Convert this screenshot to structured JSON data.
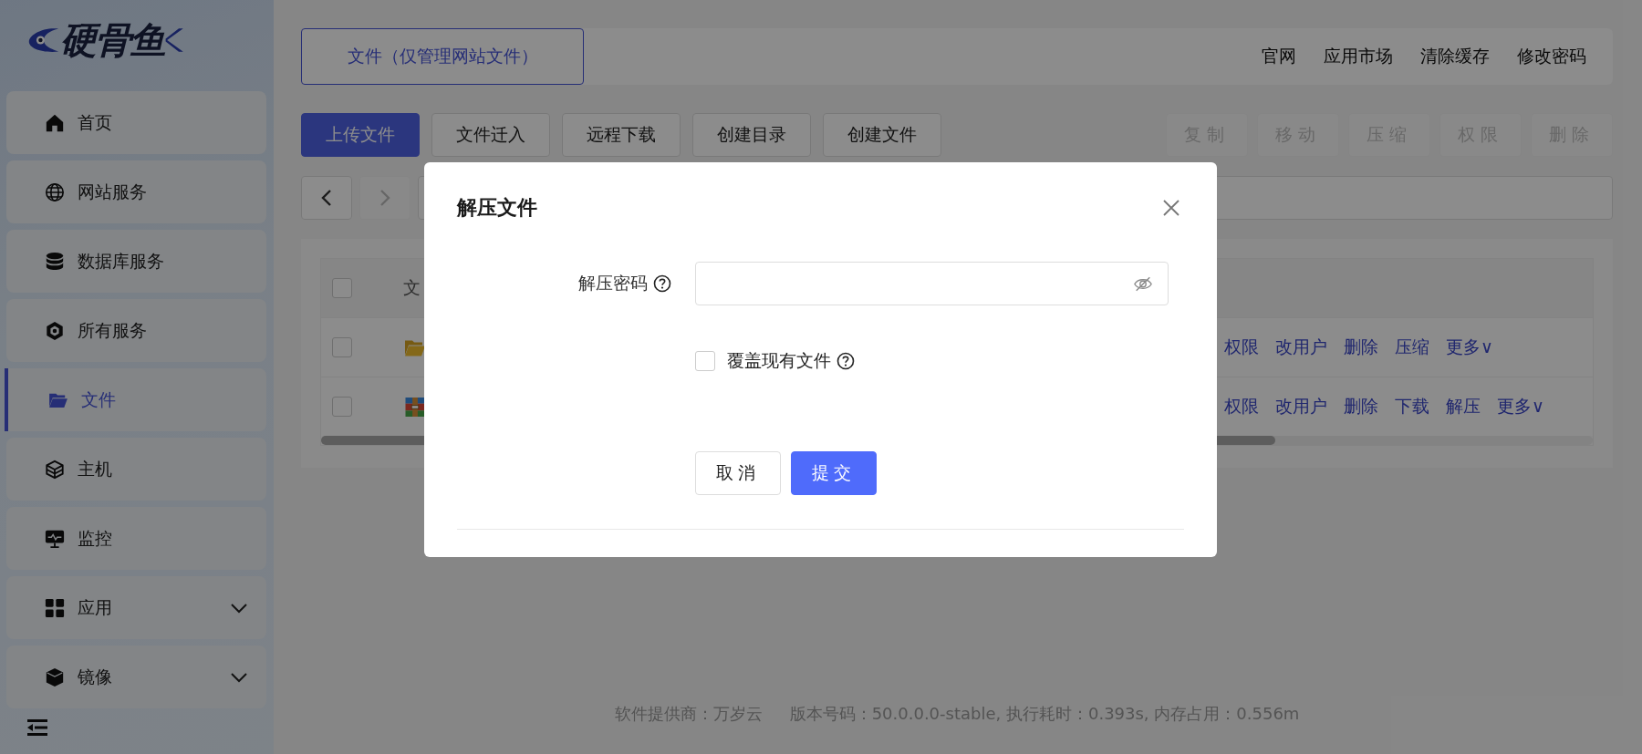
{
  "logo": {
    "text": "硬骨鱼"
  },
  "sidebar": {
    "items": [
      {
        "label": "首页",
        "selected": false,
        "submenu": false
      },
      {
        "label": "网站服务",
        "selected": false,
        "submenu": false
      },
      {
        "label": "数据库服务",
        "selected": false,
        "submenu": false
      },
      {
        "label": "所有服务",
        "selected": false,
        "submenu": false
      },
      {
        "label": "文件",
        "selected": true,
        "submenu": false
      },
      {
        "label": "主机",
        "selected": false,
        "submenu": false
      },
      {
        "label": "监控",
        "selected": false,
        "submenu": false
      },
      {
        "label": "应用",
        "selected": false,
        "submenu": true
      },
      {
        "label": "镜像",
        "selected": false,
        "submenu": true
      }
    ]
  },
  "header": {
    "tab": {
      "label": "文件（仅管理网站文件）",
      "selected": true
    },
    "links": [
      "官网",
      "应用市场",
      "清除缓存",
      "修改密码"
    ]
  },
  "toolbar": {
    "left": [
      {
        "label": "上传文件",
        "primary": true
      },
      {
        "label": "文件迁入",
        "primary": false
      },
      {
        "label": "远程下载",
        "primary": false
      },
      {
        "label": "创建目录",
        "primary": false
      },
      {
        "label": "创建文件",
        "primary": false
      }
    ],
    "right": [
      {
        "label": "复制",
        "disabled": true
      },
      {
        "label": "移动",
        "disabled": true
      },
      {
        "label": "压缩",
        "disabled": true
      },
      {
        "label": "权限",
        "disabled": true
      },
      {
        "label": "删除",
        "disabled": true
      }
    ]
  },
  "nav": {
    "back": {
      "disabled": false
    },
    "forward": {
      "disabled": true
    }
  },
  "table": {
    "header": {
      "checked": false,
      "column_2": "文"
    },
    "rows": [
      {
        "checked": false,
        "kind": "folder",
        "actions": [
          "权限",
          "改用户",
          "删除",
          "压缩",
          "更多∨"
        ]
      },
      {
        "checked": false,
        "kind": "archive",
        "actions": [
          "权限",
          "改用户",
          "删除",
          "下载",
          "解压",
          "更多∨"
        ]
      }
    ]
  },
  "footer": [
    "软件提供商：万岁云",
    "版本号码：50.0.0.0-stable, 执行耗时：0.393s, 内存占用：0.556m"
  ],
  "dialog": {
    "title": "解压文件",
    "password": {
      "label": "解压密码"
    },
    "overwrite": {
      "label": "覆盖现有文件",
      "checked": false
    },
    "buttons": [
      {
        "label": "取消",
        "primary": false
      },
      {
        "label": "提交",
        "primary": true
      }
    ]
  }
}
